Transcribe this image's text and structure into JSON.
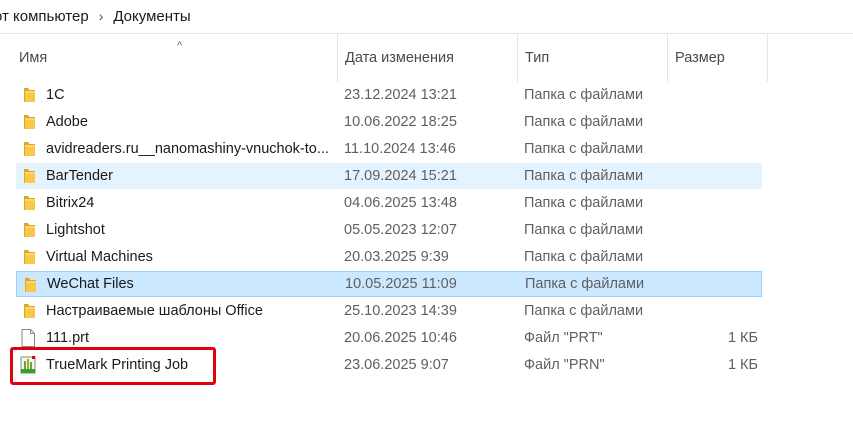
{
  "breadcrumb": {
    "items": [
      "от компьютер",
      "Документы"
    ],
    "separator": "›"
  },
  "columns": {
    "name": "Имя",
    "date": "Дата изменения",
    "type": "Тип",
    "size": "Размер",
    "sort_indicator": "^"
  },
  "files": [
    {
      "name": "1C",
      "date": "23.12.2024 13:21",
      "type": "Папка с файлами",
      "size": "",
      "icon": "folder-icon",
      "state": "normal"
    },
    {
      "name": "Adobe",
      "date": "10.06.2022 18:25",
      "type": "Папка с файлами",
      "size": "",
      "icon": "folder-icon",
      "state": "normal"
    },
    {
      "name": "avidreaders.ru__nanomashiny-vnuchok-to...",
      "date": "11.10.2024 13:46",
      "type": "Папка с файлами",
      "size": "",
      "icon": "folder-icon",
      "state": "normal"
    },
    {
      "name": "BarTender",
      "date": "17.09.2024 15:21",
      "type": "Папка с файлами",
      "size": "",
      "icon": "folder-icon",
      "state": "hover"
    },
    {
      "name": "Bitrix24",
      "date": "04.06.2025 13:48",
      "type": "Папка с файлами",
      "size": "",
      "icon": "folder-icon",
      "state": "normal"
    },
    {
      "name": "Lightshot",
      "date": "05.05.2023 12:07",
      "type": "Папка с файлами",
      "size": "",
      "icon": "folder-icon",
      "state": "normal"
    },
    {
      "name": "Virtual Machines",
      "date": "20.03.2025 9:39",
      "type": "Папка с файлами",
      "size": "",
      "icon": "folder-icon",
      "state": "normal"
    },
    {
      "name": "WeChat Files",
      "date": "10.05.2025 11:09",
      "type": "Папка с файлами",
      "size": "",
      "icon": "folder-icon",
      "state": "selected"
    },
    {
      "name": "Настраиваемые шаблоны Office",
      "date": "25.10.2023 14:39",
      "type": "Папка с файлами",
      "size": "",
      "icon": "folder-icon",
      "state": "normal"
    },
    {
      "name": "111.prt",
      "date": "20.06.2025 10:46",
      "type": "Файл \"PRT\"",
      "size": "1 КБ",
      "icon": "document-icon",
      "state": "normal"
    },
    {
      "name": "TrueMark Printing Job",
      "date": "23.06.2025 9:07",
      "type": "Файл \"PRN\"",
      "size": "1 КБ",
      "icon": "print-job-icon",
      "state": "normal"
    }
  ],
  "colors": {
    "folder": "#f8c948",
    "hover_row": "#e5f3ff",
    "selected_row": "#cce8ff",
    "highlight_box": "#e0000f"
  }
}
